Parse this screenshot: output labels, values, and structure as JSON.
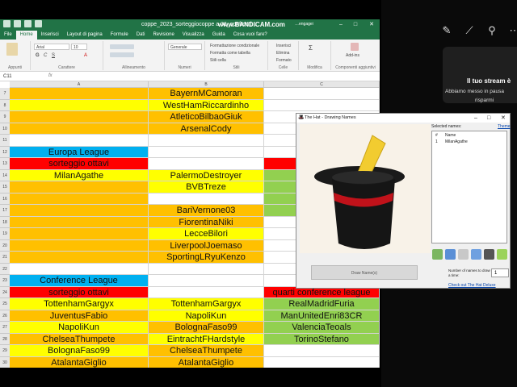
{
  "excel": {
    "title": "coppe_2023_sorteggiocoppe a 36_confronti...",
    "title_owner": "…engagei",
    "recorder_watermark": "www.BANDICAM.com",
    "menu": [
      "File",
      "Home",
      "Inserisci",
      "Layout di pagina",
      "Formule",
      "Dati",
      "Revisione",
      "Visualizza",
      "Guida",
      "Cosa vuoi fare?"
    ],
    "active_menu": "Home",
    "ribbon": {
      "clipboard": "Appunti",
      "font_name": "Arial",
      "font_size": "10",
      "font_group": "Carattere",
      "alignment": "Allineamento",
      "number_format": "Generale",
      "number_group": "Numeri",
      "cond_format": "Formattazione condizionale",
      "format_table": "Formatta come tabella",
      "cell_styles": "Stili cella",
      "styles_group": "Stili",
      "insert": "Inserisci",
      "delete": "Elimina",
      "format": "Formato",
      "cells_group": "Celle",
      "edit_group": "Modifica",
      "addins": "Add-ins",
      "addins_group": "Componenti aggiuntivi"
    },
    "name_box": "C11",
    "columns": [
      "A",
      "B",
      "C"
    ],
    "rows": [
      {
        "n": "7",
        "a": "",
        "ac": "orange",
        "b": "BayernMCamoran",
        "bc": "orange",
        "c": "",
        "cc": "white"
      },
      {
        "n": "8",
        "a": "",
        "ac": "yellow",
        "b": "WestHamRiccardinho",
        "bc": "yellow",
        "c": "",
        "cc": "white"
      },
      {
        "n": "9",
        "a": "",
        "ac": "orange",
        "b": "AtleticoBilbaoGiuk",
        "bc": "orange",
        "c": "",
        "cc": "white"
      },
      {
        "n": "10",
        "a": "",
        "ac": "orange",
        "b": "ArsenalCody",
        "bc": "orange",
        "c": "",
        "cc": "white"
      },
      {
        "n": "11",
        "a": "",
        "ac": "white",
        "b": "",
        "bc": "white",
        "c": "",
        "cc": "white"
      },
      {
        "n": "12",
        "a": "Europa League",
        "ac": "blue",
        "b": "",
        "bc": "white",
        "c": "",
        "cc": "white"
      },
      {
        "n": "13",
        "a": "sorteggio ottavi",
        "ac": "red",
        "b": "",
        "bc": "white",
        "c": "quart",
        "cc": "red"
      },
      {
        "n": "14",
        "a": "MilanAgathe",
        "ac": "yellow",
        "b": "PalermoDestroyer",
        "bc": "yellow",
        "c": "Atlet",
        "cc": "green"
      },
      {
        "n": "15",
        "a": "",
        "ac": "orange",
        "b": "BVBTreze",
        "bc": "yellow",
        "c": "Ron",
        "cc": "green"
      },
      {
        "n": "16",
        "a": "",
        "ac": "orange",
        "b": "",
        "bc": "white",
        "c": "Co",
        "cc": "green"
      },
      {
        "n": "17",
        "a": "",
        "ac": "orange",
        "b": "BariVernone03",
        "bc": "orange",
        "c": "Bay",
        "cc": "green"
      },
      {
        "n": "18",
        "a": "",
        "ac": "orange",
        "b": "FiorentinaNiki",
        "bc": "orange",
        "c": "",
        "cc": "white"
      },
      {
        "n": "19",
        "a": "",
        "ac": "orange",
        "b": "LecceBilori",
        "bc": "yellow",
        "c": "",
        "cc": "white"
      },
      {
        "n": "20",
        "a": "",
        "ac": "orange",
        "b": "LiverpoolJoemaso",
        "bc": "orange",
        "c": "",
        "cc": "white"
      },
      {
        "n": "21",
        "a": "",
        "ac": "orange",
        "b": "SportingLRyuKenzo",
        "bc": "orange",
        "c": "",
        "cc": "white"
      },
      {
        "n": "22",
        "a": "",
        "ac": "white",
        "b": "",
        "bc": "white",
        "c": "",
        "cc": "white"
      },
      {
        "n": "23",
        "a": "Conference League",
        "ac": "blue",
        "b": "",
        "bc": "white",
        "c": "",
        "cc": "white"
      },
      {
        "n": "24",
        "a": "sorteggio ottavi",
        "ac": "red",
        "b": "",
        "bc": "white",
        "c": "quarti conference league",
        "cc": "red"
      },
      {
        "n": "25",
        "a": "TottenhamGargyx",
        "ac": "yellow",
        "b": "TottenhamGargyx",
        "bc": "yellow",
        "c": "RealMadridFuria",
        "cc": "green"
      },
      {
        "n": "26",
        "a": "JuventusFabio",
        "ac": "orange",
        "b": "NapoliKun",
        "bc": "yellow",
        "c": "ManUnitedEnri83CR",
        "cc": "green"
      },
      {
        "n": "27",
        "a": "NapoliKun",
        "ac": "yellow",
        "b": "BolognaFaso99",
        "bc": "orange",
        "c": "ValenciaTeoals",
        "cc": "green"
      },
      {
        "n": "28",
        "a": "ChelseaThumpete",
        "ac": "orange",
        "b": "EintrachtFHardstyle",
        "bc": "yellow",
        "c": "TorinoStefano",
        "cc": "green"
      },
      {
        "n": "29",
        "a": "BolognaFaso99",
        "ac": "yellow",
        "b": "ChelseaThumpete",
        "bc": "orange",
        "c": "",
        "cc": "white"
      },
      {
        "n": "30",
        "a": "AtalantaGiglio",
        "ac": "orange",
        "b": "AtalantaGiglio",
        "bc": "orange",
        "c": "",
        "cc": "white"
      }
    ]
  },
  "stream": {
    "title": "Il tuo stream è",
    "line1": "Abbiamo messo in pausa",
    "line2": "risparmi"
  },
  "hat_app": {
    "title": "The Hat - Drawing Names",
    "selected_names_label": "Selected names:",
    "theme_link": "Theme",
    "col_num": "#",
    "col_name": "Name",
    "entries": [
      {
        "num": "1",
        "name": "MilanAgathe"
      }
    ],
    "draw_button": "Draw Name(s)",
    "count_label": "Number of names to draw at a time:",
    "count_value": "1",
    "deluxe_link": "Check out The Hat Deluxe"
  },
  "colors": {
    "excel_green": "#217346",
    "orange": "#ffc000",
    "yellow": "#ffff00",
    "blue": "#00b0f0",
    "red": "#ff0000",
    "green": "#92d050"
  }
}
